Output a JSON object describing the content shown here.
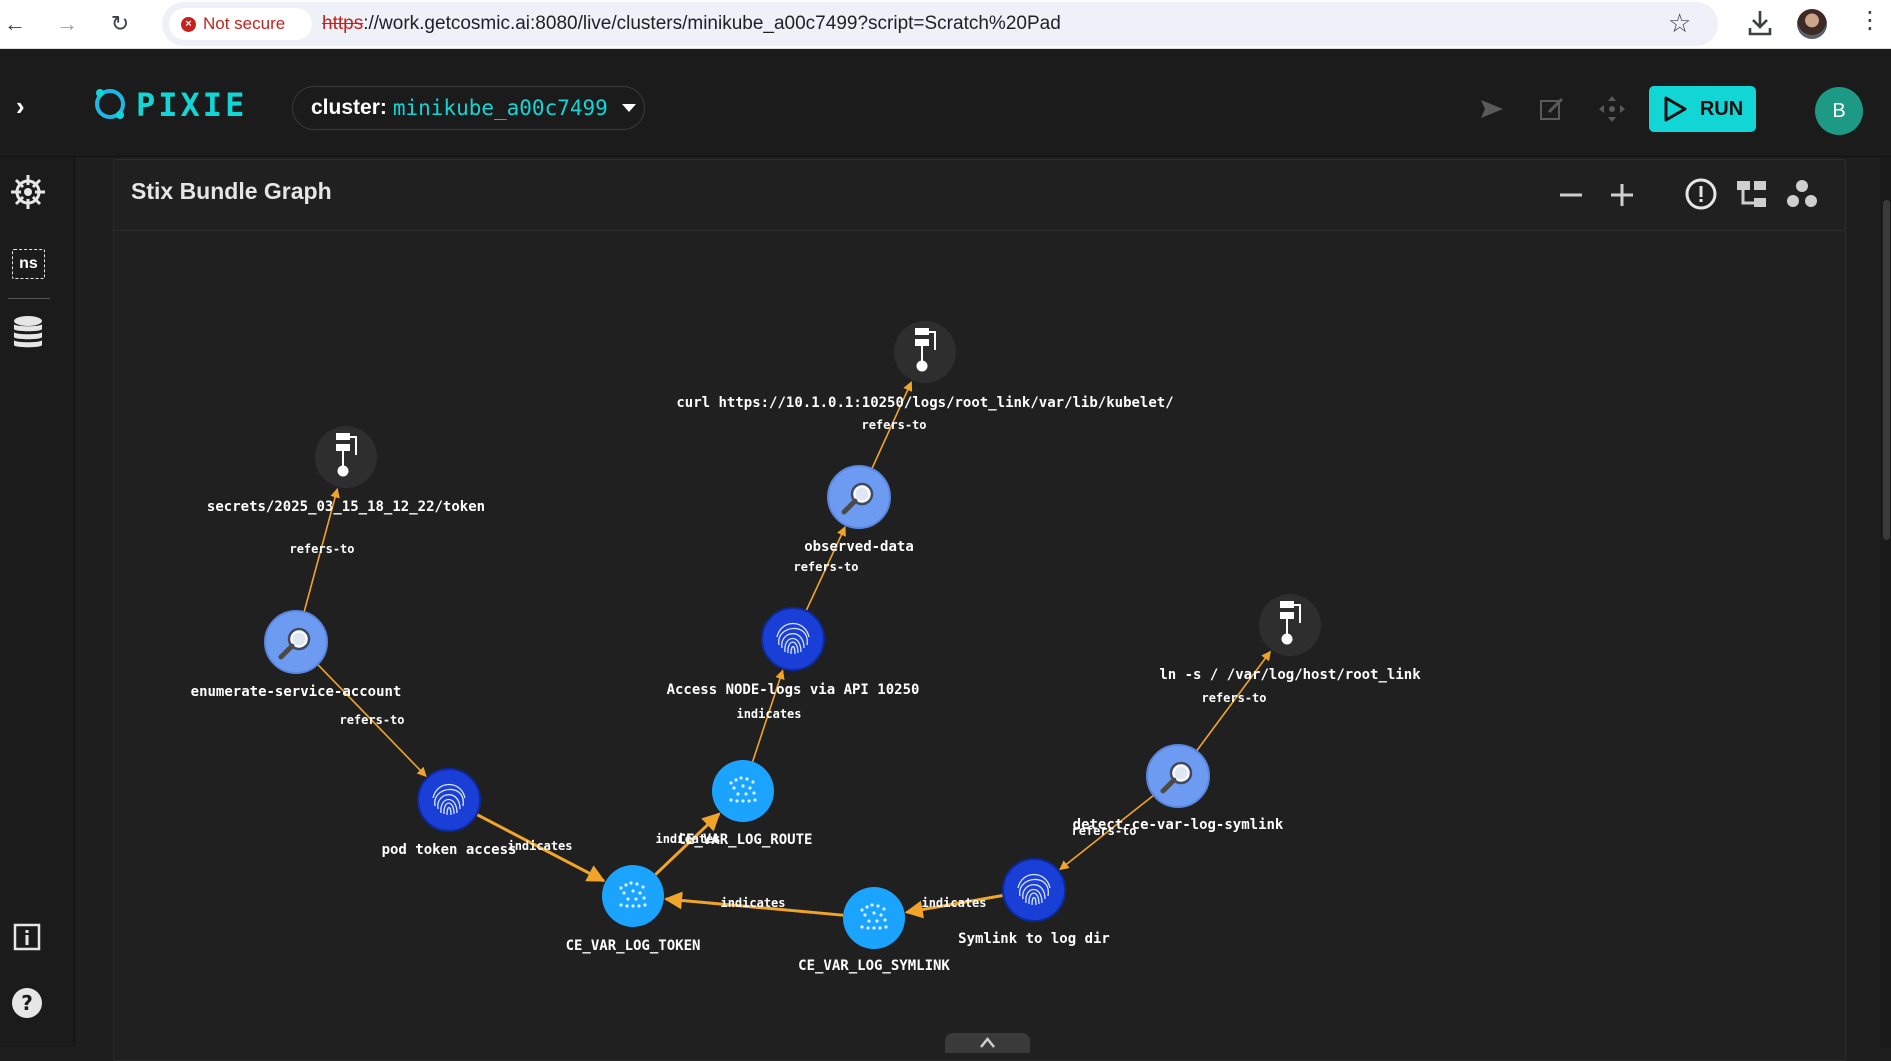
{
  "browser": {
    "security_label": "Not secure",
    "url_scheme": "https",
    "url_rest": "://work.getcosmic.ai:8080/live/clusters/minikube_a00c7499?script=Scratch%20Pad"
  },
  "header": {
    "logo_text": "PIXIE",
    "cluster_label": "cluster:",
    "cluster_value": "minikube_a00c7499",
    "run_label": "RUN",
    "avatar_initial": "B"
  },
  "rail": {
    "ns_label": "ns"
  },
  "panel": {
    "title": "Stix Bundle Graph"
  },
  "graph": {
    "nodes": [
      {
        "label": "curl https://10.1.0.1:10250/logs/root_link/var/lib/kubelet/",
        "kind": "process",
        "icon": "process-icon"
      },
      {
        "label": "observed-data",
        "kind": "observed",
        "icon": "magnifier-icon"
      },
      {
        "label": "Access NODE-logs via API 10250",
        "kind": "indicator",
        "icon": "fingerprint-icon"
      },
      {
        "label": "CE_VAR_LOG_ROUTE",
        "kind": "vulnerability",
        "icon": "network-icon"
      },
      {
        "label": "secrets/2025_03_15_18_12_22/token",
        "kind": "process",
        "icon": "process-icon"
      },
      {
        "label": "enumerate-service-account",
        "kind": "observed",
        "icon": "magnifier-icon"
      },
      {
        "label": "pod token access",
        "kind": "indicator",
        "icon": "fingerprint-icon"
      },
      {
        "label": "CE_VAR_LOG_TOKEN",
        "kind": "vulnerability",
        "icon": "network-icon"
      },
      {
        "label": "CE_VAR_LOG_SYMLINK",
        "kind": "vulnerability",
        "icon": "network-icon"
      },
      {
        "label": "Symlink to log dir",
        "kind": "indicator",
        "icon": "fingerprint-icon"
      },
      {
        "label": "detect-ce-var-log-symlink",
        "kind": "observed",
        "icon": "magnifier-icon"
      },
      {
        "label": "ln -s / /var/log/host/root_link",
        "kind": "process",
        "icon": "process-icon"
      }
    ],
    "edges": [
      {
        "from": 1,
        "to": 0,
        "label": "refers-to"
      },
      {
        "from": 2,
        "to": 1,
        "label": "refers-to"
      },
      {
        "from": 3,
        "to": 2,
        "label": "indicates"
      },
      {
        "from": 5,
        "to": 4,
        "label": "refers-to"
      },
      {
        "from": 5,
        "to": 6,
        "label": "refers-to"
      },
      {
        "from": 6,
        "to": 7,
        "label": "indicates"
      },
      {
        "from": 7,
        "to": 3,
        "label": "indicates"
      },
      {
        "from": 8,
        "to": 7,
        "label": "indicates"
      },
      {
        "from": 9,
        "to": 8,
        "label": "indicates"
      },
      {
        "from": 10,
        "to": 9,
        "label": "refers-to"
      },
      {
        "from": 10,
        "to": 11,
        "label": "refers-to"
      }
    ],
    "colors": {
      "edge": "#f0a52a",
      "process": "#2e2e2e",
      "observed": "#6e9bf2",
      "indicator": "#1a3fd6",
      "vulnerability": "#1aa3ff"
    }
  }
}
